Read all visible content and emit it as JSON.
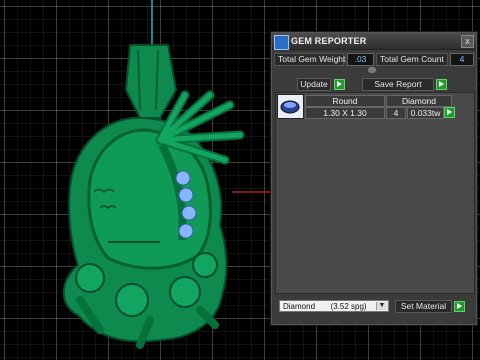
{
  "panel": {
    "title": "GEM REPORTER",
    "close_glyph": "x",
    "total_weight_label": "Total Gem Weight",
    "total_weight_value": ".03",
    "total_count_label": "Total Gem Count",
    "total_count_value": "4",
    "update_label": "Update",
    "save_report_label": "Save Report",
    "table": {
      "headers": [
        "Round",
        "Diamond"
      ],
      "rows": [
        {
          "size": "1.30 X 1.30",
          "count": "4",
          "weight": "0.033tw"
        }
      ]
    },
    "material_select": "Diamond       (3.52 spg)",
    "set_material_label": "Set Material"
  },
  "colors": {
    "model": "#0e8a4f",
    "model_dark": "#055a32",
    "gem": "#86b6ff",
    "panel": "#3b3b3b",
    "accent_green": "#1e9b2e"
  },
  "icons": [
    "gem-reporter-icon",
    "close-icon",
    "collapse-arrow-icon",
    "go-arrow-icon",
    "gem-thumbnail-icon",
    "dropdown-arrow-icon"
  ]
}
